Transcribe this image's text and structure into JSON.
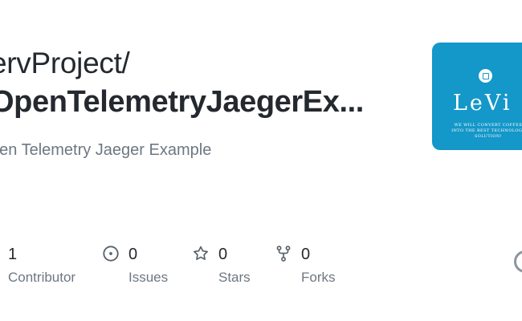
{
  "repo": {
    "owner": "ServProject/",
    "owner_visible": "ervProject/",
    "name": "OpenTelemetryJaegerEx...",
    "name_visible": "OpenTelemetryJaegerEx...",
    "description": "pen Telemetry Jaeger Example"
  },
  "avatar": {
    "name": "LeVi",
    "tagline": "WE WILL CONVERT COFFEE INTO THE BEST TECHNOLOGY SOLUTION!",
    "background": "#1497c9"
  },
  "stats": [
    {
      "icon": "contributors-icon",
      "count": "1",
      "label": "Contributor"
    },
    {
      "icon": "issues-icon",
      "count": "0",
      "label": "Issues"
    },
    {
      "icon": "star-icon",
      "count": "0",
      "label": "Stars"
    },
    {
      "icon": "fork-icon",
      "count": "0",
      "label": "Forks"
    }
  ],
  "colors": {
    "text": "#24292f",
    "muted": "#6e7781",
    "brand": "#1497c9"
  }
}
